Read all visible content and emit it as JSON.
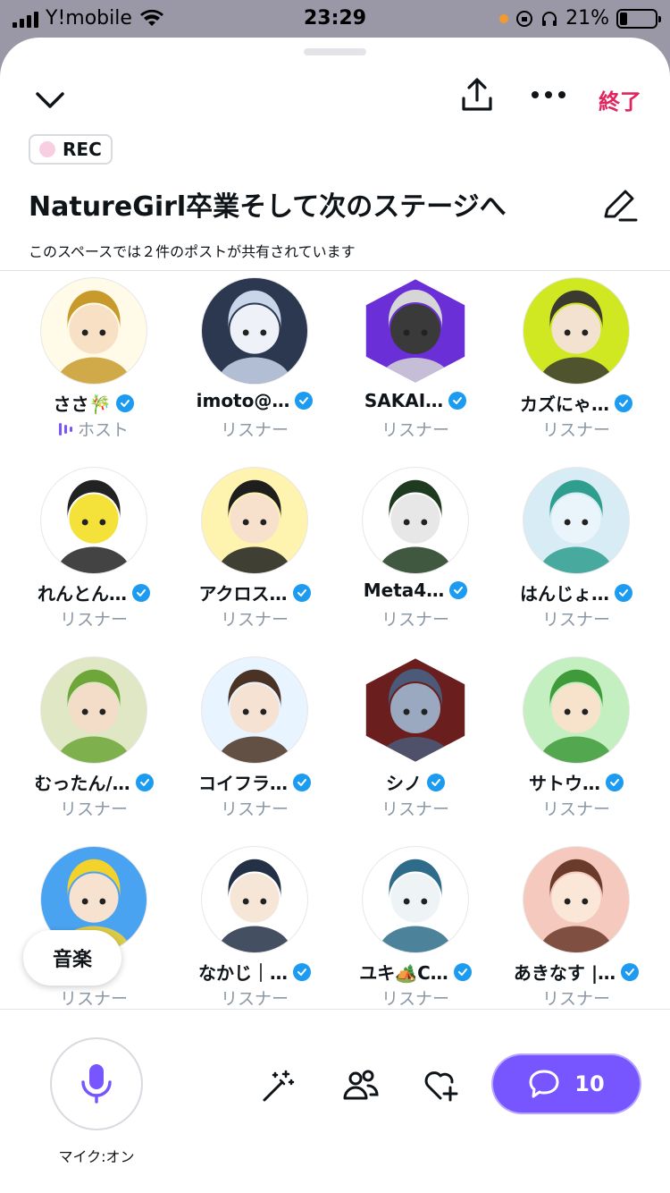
{
  "status_bar": {
    "carrier": "Y!mobile",
    "time": "23:29",
    "battery": "21%"
  },
  "header": {
    "end_label": "終了",
    "rec_label": "REC",
    "title": "NatureGirl卒業そして次のステージへ",
    "subtitle": "このスペースでは２件のポストが共有されています"
  },
  "participants": [
    {
      "name": "ささ🎋",
      "role": "ホスト"
    },
    {
      "name": "imoto@…",
      "role": "リスナー"
    },
    {
      "name": "SAKAI…",
      "role": "リスナー"
    },
    {
      "name": "カズにゃ…",
      "role": "リスナー"
    },
    {
      "name": "れんとん…",
      "role": "リスナー"
    },
    {
      "name": "アクロス…",
      "role": "リスナー"
    },
    {
      "name": "Meta4…",
      "role": "リスナー"
    },
    {
      "name": "はんじょ…",
      "role": "リスナー"
    },
    {
      "name": "むったん/…",
      "role": "リスナー"
    },
    {
      "name": "コイフラ…",
      "role": "リスナー"
    },
    {
      "name": "シノ",
      "role": "リスナー"
    },
    {
      "name": "サトウ…",
      "role": "リスナー"
    },
    {
      "name": "",
      "role": "リスナー"
    },
    {
      "name": "なかじ｜…",
      "role": "リスナー"
    },
    {
      "name": "ユキ🏕️C…",
      "role": "リスナー"
    },
    {
      "name": "あきなす |…",
      "role": "リスナー"
    }
  ],
  "music_label": "音楽",
  "footer": {
    "mic_label": "マイク:オン",
    "comment_count": "10"
  },
  "colors": {
    "accent": "#7856ff",
    "end": "#e0245e",
    "verified": "#1d9bf0",
    "muted": "#8b98a5"
  }
}
